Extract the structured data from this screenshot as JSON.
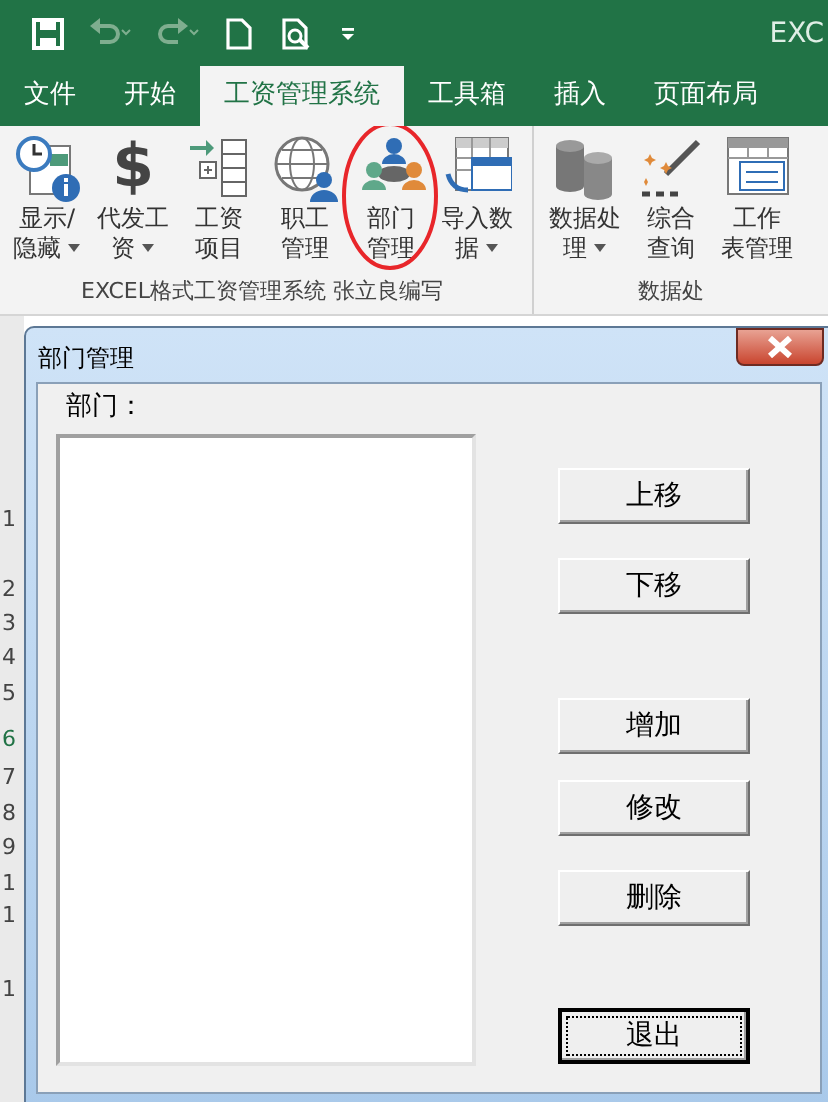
{
  "title_bar": {
    "title": "EXC",
    "quick_access": [
      {
        "kind": "save",
        "disabled": false
      },
      {
        "kind": "undo",
        "disabled": true
      },
      {
        "kind": "redo",
        "disabled": true
      },
      {
        "kind": "new",
        "disabled": false
      },
      {
        "kind": "preview",
        "disabled": false
      },
      {
        "kind": "customize",
        "disabled": false
      }
    ]
  },
  "tabs": [
    {
      "label": "文件",
      "selected": false
    },
    {
      "label": "开始",
      "selected": false
    },
    {
      "label": "工资管理系统",
      "selected": true
    },
    {
      "label": "工具箱",
      "selected": false
    },
    {
      "label": "插入",
      "selected": false
    },
    {
      "label": "页面布局",
      "selected": false
    }
  ],
  "ribbon_groups": [
    {
      "label": "EXCEL格式工资管理系统  张立良编写",
      "buttons": [
        {
          "lines": [
            "显示/",
            "隐藏"
          ],
          "dropdown": true,
          "highlighted": false
        },
        {
          "lines": [
            "代发工",
            "资"
          ],
          "glyph": "$",
          "dropdown": true,
          "highlighted": false
        },
        {
          "lines": [
            "工资",
            "项目"
          ],
          "dropdown": false,
          "highlighted": false
        },
        {
          "lines": [
            "职工",
            "管理"
          ],
          "dropdown": false,
          "highlighted": false
        },
        {
          "lines": [
            "部门",
            "管理"
          ],
          "dropdown": false,
          "highlighted": true
        },
        {
          "lines": [
            "导入数",
            "据"
          ],
          "dropdown": true,
          "highlighted": false
        }
      ]
    },
    {
      "label": "数据处",
      "buttons": [
        {
          "lines": [
            "数据处",
            "理"
          ],
          "dropdown": true,
          "highlighted": false
        },
        {
          "lines": [
            "综合",
            "查询"
          ],
          "dropdown": false,
          "highlighted": false
        },
        {
          "lines": [
            "工作",
            "表管理"
          ],
          "dropdown": false,
          "highlighted": false
        }
      ]
    }
  ],
  "row_numbers": [
    "1",
    "2",
    "3",
    "4",
    "5",
    "6",
    "7",
    "8",
    "9",
    "1",
    "1",
    "1"
  ],
  "dialog": {
    "title": "部门管理",
    "list_label": "部门：",
    "buttons": [
      {
        "label": "上移",
        "default": false
      },
      {
        "label": "下移",
        "default": false
      },
      {
        "label": "增加",
        "default": false
      },
      {
        "label": "修改",
        "default": false
      },
      {
        "label": "删除",
        "default": false
      },
      {
        "label": "退出",
        "default": true
      }
    ]
  }
}
